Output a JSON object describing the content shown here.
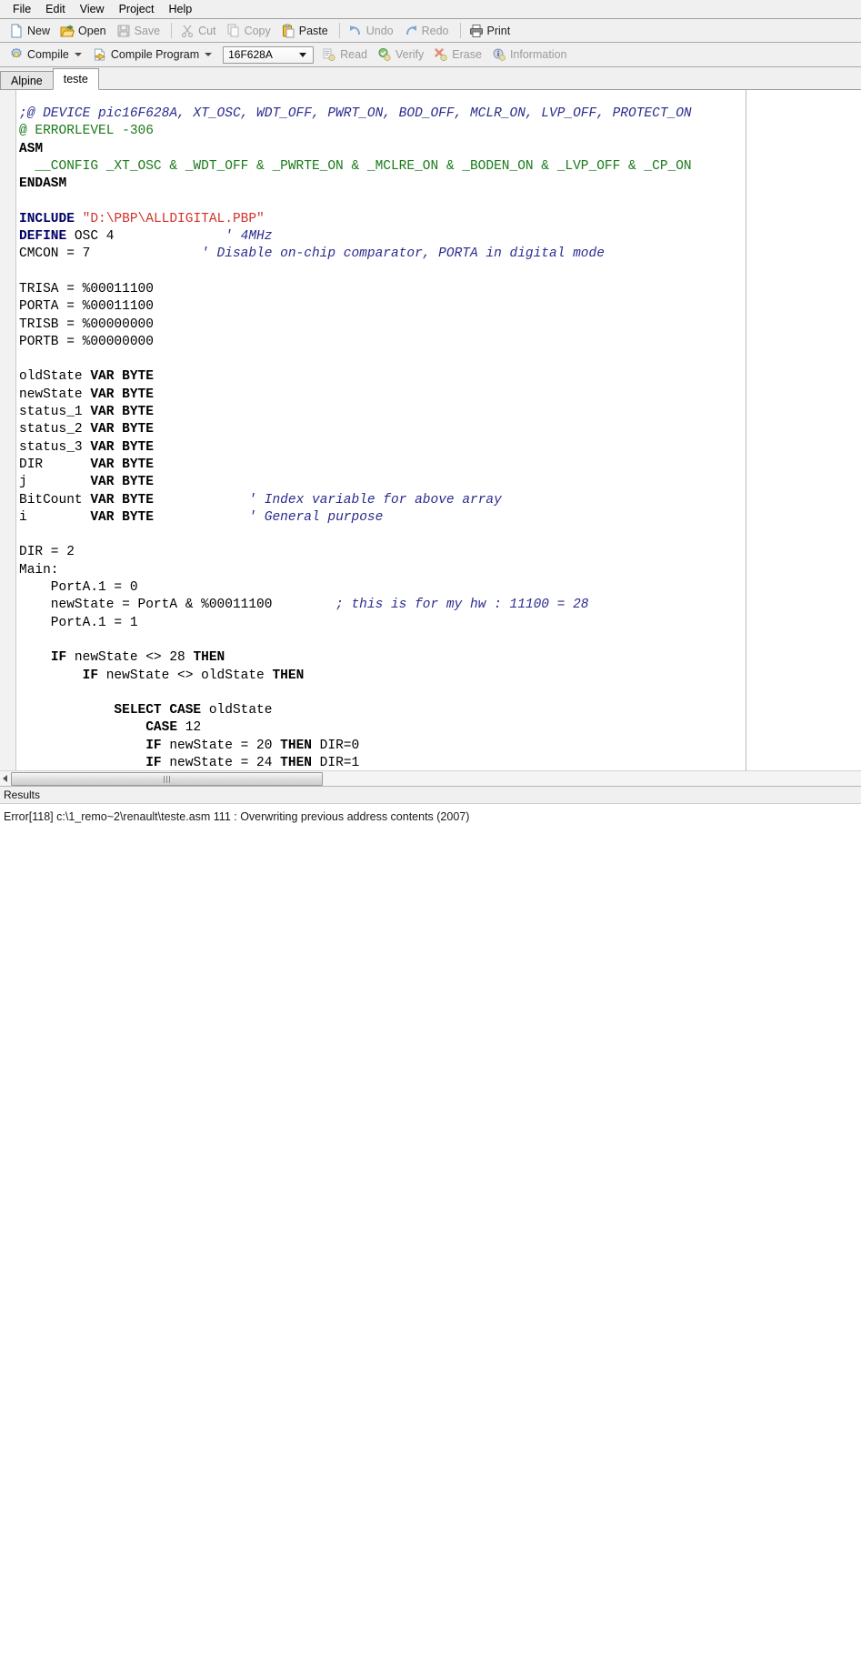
{
  "menubar": {
    "items": [
      {
        "label": "File",
        "name": "menu-file"
      },
      {
        "label": "Edit",
        "name": "menu-edit"
      },
      {
        "label": "View",
        "name": "menu-view"
      },
      {
        "label": "Project",
        "name": "menu-project"
      },
      {
        "label": "Help",
        "name": "menu-help"
      }
    ]
  },
  "toolbar1": {
    "new_label": "New",
    "open_label": "Open",
    "save_label": "Save",
    "cut_label": "Cut",
    "copy_label": "Copy",
    "paste_label": "Paste",
    "undo_label": "Undo",
    "redo_label": "Redo",
    "print_label": "Print"
  },
  "toolbar2": {
    "compile_label": "Compile",
    "compile_program_label": "Compile Program",
    "device_value": "16F628A",
    "read_label": "Read",
    "verify_label": "Verify",
    "erase_label": "Erase",
    "information_label": "Information"
  },
  "tabs": [
    {
      "label": "Alpine",
      "active": false
    },
    {
      "label": "teste",
      "active": true
    }
  ],
  "editor": {
    "lines": [
      {
        "segments": [
          {
            "t": ";@ DEVICE pic16F628A, XT_OSC, WDT_OFF, PWRT_ON, BOD_OFF, MCLR_ON, LVP_OFF, PROTECT_ON",
            "c": "cmt"
          }
        ]
      },
      {
        "segments": [
          {
            "t": "@ ERRORLEVEL -306",
            "c": "cmtg"
          }
        ]
      },
      {
        "segments": [
          {
            "t": "ASM",
            "c": "kw"
          }
        ]
      },
      {
        "segments": [
          {
            "t": "  __CONFIG _XT_OSC & _WDT_OFF & _PWRTE_ON & _MCLRE_ON & _BODEN_ON & _LVP_OFF & _CP_ON",
            "c": "cmtg"
          }
        ]
      },
      {
        "segments": [
          {
            "t": "ENDASM",
            "c": "kw"
          }
        ]
      },
      {
        "segments": [
          {
            "t": "",
            "c": ""
          }
        ]
      },
      {
        "segments": [
          {
            "t": "INCLUDE ",
            "c": "kwn"
          },
          {
            "t": "\"D:\\PBP\\ALLDIGITAL.PBP\"",
            "c": "str"
          }
        ]
      },
      {
        "segments": [
          {
            "t": "DEFINE ",
            "c": "kwn"
          },
          {
            "t": "OSC 4              ",
            "c": ""
          },
          {
            "t": "' 4MHz",
            "c": "cmt"
          }
        ]
      },
      {
        "segments": [
          {
            "t": "CMCON = 7              ",
            "c": ""
          },
          {
            "t": "' Disable on-chip comparator, PORTA in digital mode",
            "c": "cmt"
          }
        ]
      },
      {
        "segments": [
          {
            "t": "",
            "c": ""
          }
        ]
      },
      {
        "segments": [
          {
            "t": "TRISA = %00011100",
            "c": ""
          }
        ]
      },
      {
        "segments": [
          {
            "t": "PORTA = %00011100",
            "c": ""
          }
        ]
      },
      {
        "segments": [
          {
            "t": "TRISB = %00000000",
            "c": ""
          }
        ]
      },
      {
        "segments": [
          {
            "t": "PORTB = %00000000",
            "c": ""
          }
        ]
      },
      {
        "segments": [
          {
            "t": "",
            "c": ""
          }
        ]
      },
      {
        "segments": [
          {
            "t": "oldState ",
            "c": ""
          },
          {
            "t": "VAR BYTE",
            "c": "kw"
          }
        ]
      },
      {
        "segments": [
          {
            "t": "newState ",
            "c": ""
          },
          {
            "t": "VAR BYTE",
            "c": "kw"
          }
        ]
      },
      {
        "segments": [
          {
            "t": "status_1 ",
            "c": ""
          },
          {
            "t": "VAR BYTE",
            "c": "kw"
          }
        ]
      },
      {
        "segments": [
          {
            "t": "status_2 ",
            "c": ""
          },
          {
            "t": "VAR BYTE",
            "c": "kw"
          }
        ]
      },
      {
        "segments": [
          {
            "t": "status_3 ",
            "c": ""
          },
          {
            "t": "VAR BYTE",
            "c": "kw"
          }
        ]
      },
      {
        "segments": [
          {
            "t": "DIR      ",
            "c": ""
          },
          {
            "t": "VAR BYTE",
            "c": "kw"
          }
        ]
      },
      {
        "segments": [
          {
            "t": "j        ",
            "c": ""
          },
          {
            "t": "VAR BYTE",
            "c": "kw"
          }
        ]
      },
      {
        "segments": [
          {
            "t": "BitCount ",
            "c": ""
          },
          {
            "t": "VAR BYTE",
            "c": "kw"
          },
          {
            "t": "            ",
            "c": ""
          },
          {
            "t": "' Index variable for above array",
            "c": "cmt"
          }
        ]
      },
      {
        "segments": [
          {
            "t": "i        ",
            "c": ""
          },
          {
            "t": "VAR BYTE",
            "c": "kw"
          },
          {
            "t": "            ",
            "c": ""
          },
          {
            "t": "' General purpose",
            "c": "cmt"
          }
        ]
      },
      {
        "segments": [
          {
            "t": "",
            "c": ""
          }
        ]
      },
      {
        "segments": [
          {
            "t": "DIR = 2",
            "c": ""
          }
        ]
      },
      {
        "segments": [
          {
            "t": "Main:",
            "c": ""
          }
        ]
      },
      {
        "segments": [
          {
            "t": "    PortA.1 = 0",
            "c": ""
          }
        ]
      },
      {
        "segments": [
          {
            "t": "    newState = PortA & %00011100        ",
            "c": ""
          },
          {
            "t": "; this is for my hw : 11100 = 28",
            "c": "cmt"
          }
        ]
      },
      {
        "segments": [
          {
            "t": "    PortA.1 = 1",
            "c": ""
          }
        ]
      },
      {
        "segments": [
          {
            "t": "",
            "c": ""
          }
        ]
      },
      {
        "segments": [
          {
            "t": "    ",
            "c": ""
          },
          {
            "t": "IF",
            "c": "kw"
          },
          {
            "t": " newState <> 28 ",
            "c": ""
          },
          {
            "t": "THEN",
            "c": "kw"
          }
        ]
      },
      {
        "segments": [
          {
            "t": "        ",
            "c": ""
          },
          {
            "t": "IF",
            "c": "kw"
          },
          {
            "t": " newState <> oldState ",
            "c": ""
          },
          {
            "t": "THEN",
            "c": "kw"
          }
        ]
      },
      {
        "segments": [
          {
            "t": "",
            "c": ""
          }
        ]
      },
      {
        "segments": [
          {
            "t": "            ",
            "c": ""
          },
          {
            "t": "SELECT CASE",
            "c": "kw"
          },
          {
            "t": " oldState",
            "c": ""
          }
        ]
      },
      {
        "segments": [
          {
            "t": "                ",
            "c": ""
          },
          {
            "t": "CASE",
            "c": "kw"
          },
          {
            "t": " 12",
            "c": ""
          }
        ]
      },
      {
        "segments": [
          {
            "t": "                ",
            "c": ""
          },
          {
            "t": "IF",
            "c": "kw"
          },
          {
            "t": " newState = 20 ",
            "c": ""
          },
          {
            "t": "THEN",
            "c": "kw"
          },
          {
            "t": " DIR=0",
            "c": ""
          }
        ]
      },
      {
        "segments": [
          {
            "t": "                ",
            "c": ""
          },
          {
            "t": "IF",
            "c": "kw"
          },
          {
            "t": " newState = 24 ",
            "c": ""
          },
          {
            "t": "THEN",
            "c": "kw"
          },
          {
            "t": " DIR=1",
            "c": ""
          }
        ]
      }
    ]
  },
  "results": {
    "header": "Results",
    "lines": [
      "Error[118] c:\\1_remo~2\\renault\\teste.asm 111 : Overwriting previous address contents (2007)"
    ]
  },
  "colors": {
    "comment": "#2b2b8f",
    "asm_comment": "#1a7a1a",
    "string": "#d0342c",
    "keyword": "#000000",
    "chrome": "#f0f0f0"
  }
}
